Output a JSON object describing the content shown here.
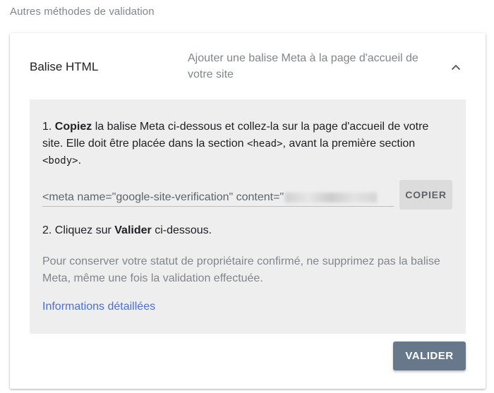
{
  "section_title": "Autres méthodes de validation",
  "method": {
    "name": "Balise HTML",
    "description": "Ajouter une balise Meta à la page d'accueil de votre site",
    "expanded_icon": "chevron-up-icon"
  },
  "instructions": {
    "step1_number": "1. ",
    "step1_bold": "Copiez",
    "step1_text_a": " la balise Meta ci-dessous et collez-la sur la page d'accueil de votre site. Elle doit être placée dans la section ",
    "step1_code_head": "<head>",
    "step1_text_b": ", avant la première section ",
    "step1_code_body": "<body>",
    "step1_text_c": ".",
    "meta_tag_value": "<meta name=\"google-site-verification\" content=\"",
    "copy_label": "COPIER",
    "step2_number": "2. Cliquez sur ",
    "step2_bold": "Valider",
    "step2_text": " ci-dessous.",
    "note": "Pour conserver votre statut de propriétaire confirmé, ne supprimez pas la balise Meta, même une fois la validation effectuée.",
    "link_label": "Informations détaillées"
  },
  "validate_label": "VALIDER",
  "colors": {
    "panel_bg": "#eeeeee",
    "link": "#4b6fd9",
    "validate_button": "#66788a"
  }
}
